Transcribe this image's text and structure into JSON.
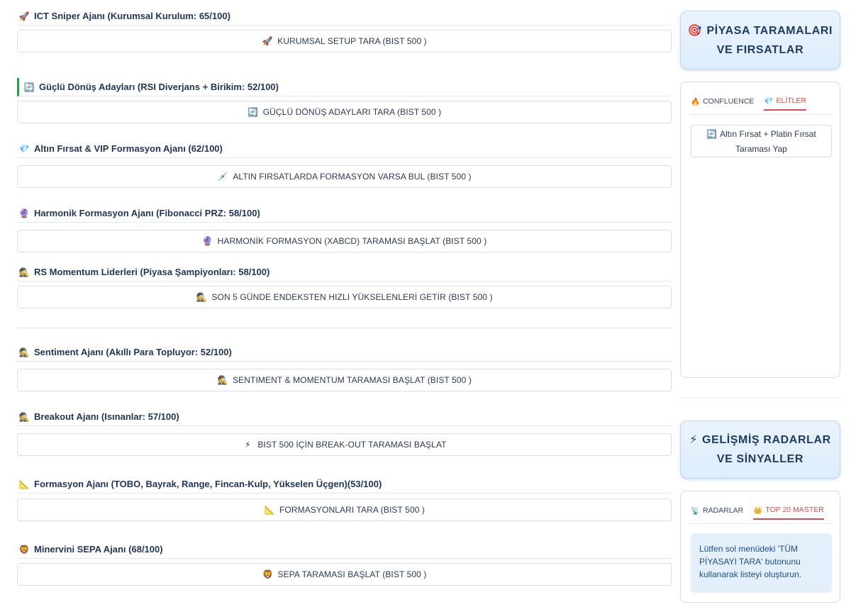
{
  "sections": [
    {
      "icon": "🚀",
      "icon_name": "rocket-icon",
      "title": "ICT Sniper Ajanı (Kurumsal Kurulum: 65/100)",
      "button_icon": "🚀",
      "button": "KURUMSAL SETUP TARA (BIST 500 )"
    },
    {
      "icon": "🔄",
      "icon_name": "refresh-icon",
      "title": "Güçlü Dönüş Adayları (RSI Diverjans + Birikim: 52/100)",
      "button_icon": "🔄",
      "button": "GÜÇLÜ DÖNÜŞ ADAYLARI TARA (BIST 500 )"
    },
    {
      "icon": "💎",
      "icon_name": "diamond-icon",
      "title": "Altın Fırsat & VIP Formasyon Ajanı (62/100)",
      "button_icon": "💉",
      "button": "ALTIN FIRSATLARDA FORMASYON VARSA BUL (BIST 500 )"
    },
    {
      "icon": "🔮",
      "icon_name": "crystal-ball-icon",
      "title": "Harmonik Formasyon Ajanı (Fibonacci PRZ: 58/100)",
      "button_icon": "🔮",
      "button": "HARMONİK FORMASYON (XABCD) TARAMASI BAŞLAT (BIST 500 )"
    },
    {
      "icon": "🕵️",
      "icon_name": "detective-icon",
      "title": "RS Momentum Liderleri (Piyasa Şampiyonları: 58/100)",
      "button_icon": "🕵️",
      "button": "SON 5 GÜNDE ENDEKSTEN HIZLI YÜKSELENLERİ GETİR (BIST 500 )"
    },
    {
      "icon": "🕵️",
      "icon_name": "detective-icon",
      "title": "Sentiment Ajanı (Akıllı Para Topluyor: 52/100)",
      "button_icon": "🕵️",
      "button": "SENTIMENT & MOMENTUM TARAMASI BAŞLAT (BIST 500 )"
    },
    {
      "icon": "🕵️",
      "icon_name": "detective-icon",
      "title": "Breakout Ajanı (Isınanlar: 57/100)",
      "button_icon": "⚡",
      "button": "BIST 500 İÇİN BREAK-OUT TARAMASI BAŞLAT"
    },
    {
      "icon": "📐",
      "icon_name": "triangle-ruler-icon",
      "title": "Formasyon Ajanı (TOBO, Bayrak, Range, Fincan-Kulp, Yükselen Üçgen)(53/100)",
      "button_icon": "📐",
      "button": "FORMASYONLARI TARA (BIST 500 )"
    },
    {
      "icon": "🦁",
      "icon_name": "lion-icon",
      "title": "Minervini SEPA Ajanı (68/100)",
      "button_icon": "🦁",
      "button": "SEPA TARAMASI BAŞLAT (BIST 500 )"
    }
  ],
  "right": {
    "header1": {
      "icon": "🎯",
      "line1": "PİYASA TARAMALARI",
      "line2": "VE FIRSATLAR"
    },
    "panel1": {
      "tabs": [
        {
          "icon": "🔥",
          "label": "CONFLUENCE",
          "active": false
        },
        {
          "icon": "💎",
          "label": "ELİTLER",
          "active": true
        }
      ],
      "button_icon": "🔄",
      "button": "Altın Fırsat + Platin Fırsat Taraması Yap"
    },
    "header2": {
      "icon": "⚡",
      "line1": "GELİŞMİŞ RADARLAR",
      "line2": "VE SİNYALLER"
    },
    "panel2": {
      "tabs": [
        {
          "icon": "📡",
          "label": "RADARLAR",
          "active": false
        },
        {
          "icon": "👑",
          "label": "TOP 20 MASTER",
          "active": true
        }
      ],
      "info": "Lütfen sol menüdeki 'TÜM PİYASAYI TARA' butonunu kullanarak listeyi oluşturun."
    }
  },
  "colors": {
    "accent_red": "#e04848",
    "header_bg": "#e5f1fc",
    "info_bg": "#e3f0fc",
    "marker_green": "#17a34a"
  }
}
